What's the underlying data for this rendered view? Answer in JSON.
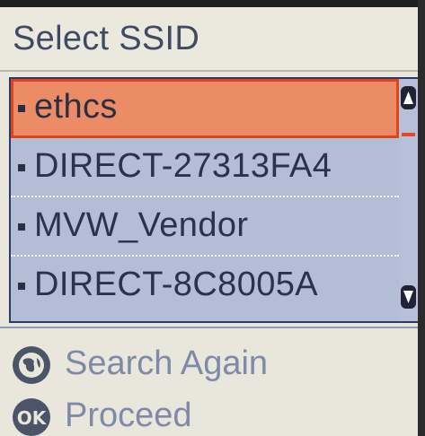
{
  "header": {
    "title": "Select SSID"
  },
  "ssid_list": {
    "items": [
      {
        "label": "ethcs",
        "selected": true
      },
      {
        "label": "DIRECT-27313FA4",
        "selected": false
      },
      {
        "label": "MVW_Vendor",
        "selected": false
      },
      {
        "label": "DIRECT-8C8005A",
        "selected": false
      }
    ]
  },
  "actions": {
    "search_again_icon": "globe-search-icon",
    "search_again_label": "Search Again",
    "proceed_icon": "ok-button-icon",
    "proceed_icon_text": "OK",
    "proceed_label": "Proceed"
  },
  "colors": {
    "selection": "#ec8c66",
    "selection_border": "#e0441b",
    "list_background": "#b3bdd6",
    "title_text": "#3f4a63",
    "action_text": "#7f8aa8"
  }
}
